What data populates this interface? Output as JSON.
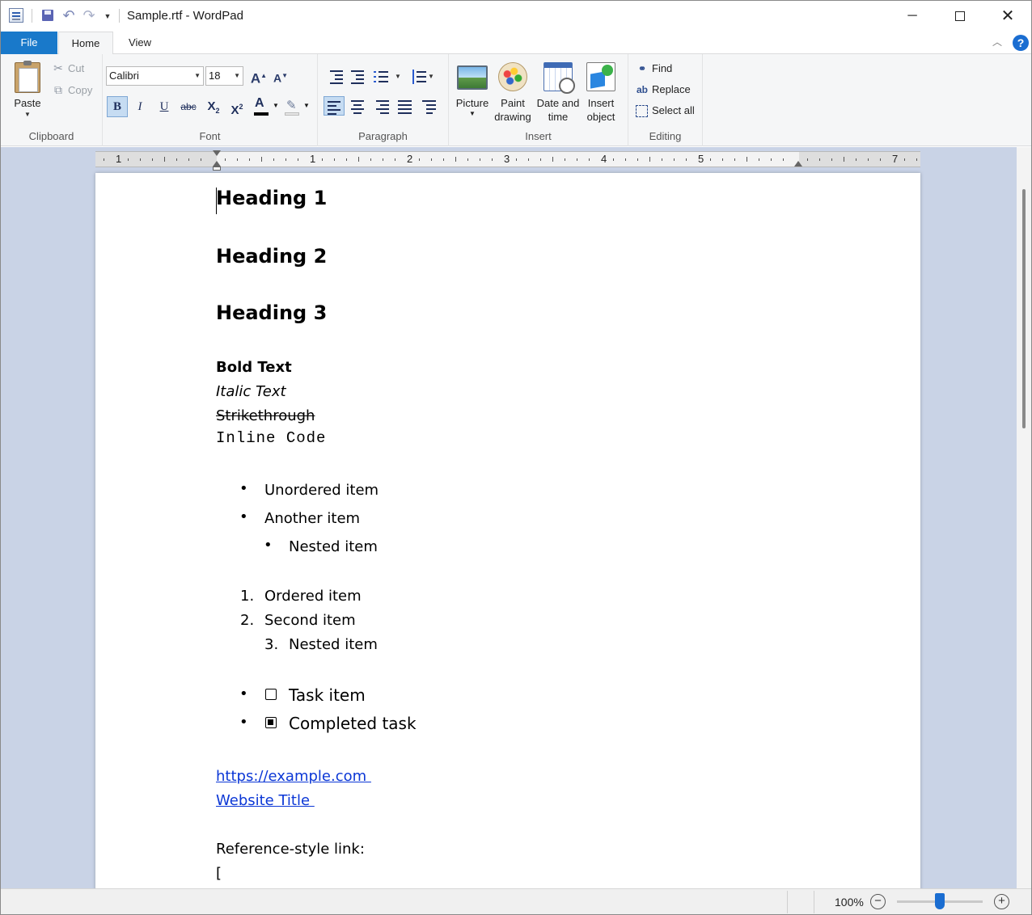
{
  "window": {
    "title": "Sample.rtf - WordPad",
    "controls": {
      "minimize": "─",
      "close": "✕"
    }
  },
  "quick_access": {
    "undo": "↶",
    "redo": "↷",
    "more": "▼"
  },
  "ribbon": {
    "tabs": [
      "File",
      "Home",
      "View"
    ],
    "collapse": "︿",
    "help": "?",
    "clipboard": {
      "label": "Clipboard",
      "paste": "Paste",
      "cut": "Cut",
      "copy": "Copy"
    },
    "font": {
      "label": "Font",
      "name": "Calibri",
      "size": "18"
    },
    "paragraph": {
      "label": "Paragraph"
    },
    "insert": {
      "label": "Insert",
      "picture": "Picture",
      "paint_line1": "Paint",
      "paint_line2": "drawing",
      "date_line1": "Date and",
      "date_line2": "time",
      "object_line1": "Insert",
      "object_line2": "object"
    },
    "editing": {
      "label": "Editing",
      "find": "Find",
      "replace": "Replace",
      "select_all": "Select all"
    }
  },
  "ruler": {
    "labels": [
      "1",
      "1",
      "2",
      "3",
      "4",
      "5",
      "7"
    ]
  },
  "document": {
    "heading1": "Heading 1",
    "heading2": "Heading 2",
    "heading3": "Heading 3",
    "bold": "Bold Text",
    "italic": "Italic Text",
    "strike": "Strikethrough",
    "code": "Inline Code",
    "unordered": [
      "Unordered item",
      "Another item",
      "Nested item"
    ],
    "ordered_numbers": [
      "1.",
      "2.",
      "3."
    ],
    "ordered": [
      "Ordered item",
      "Second item",
      "Nested item"
    ],
    "tasks": [
      {
        "text": "Task item",
        "done": false
      },
      {
        "text": "Completed task",
        "done": true
      }
    ],
    "links": [
      "https://example.com ",
      "Website Title "
    ],
    "reference_label": "Reference-style link:",
    "bracket": "["
  },
  "status": {
    "zoom": "100%",
    "zoom_level_percent": 100,
    "zoom_out": "−",
    "zoom_in": "+"
  },
  "colors": {
    "accent": "#1979ca",
    "link": "#0b37d6",
    "workspace": "#c9d3e6"
  }
}
